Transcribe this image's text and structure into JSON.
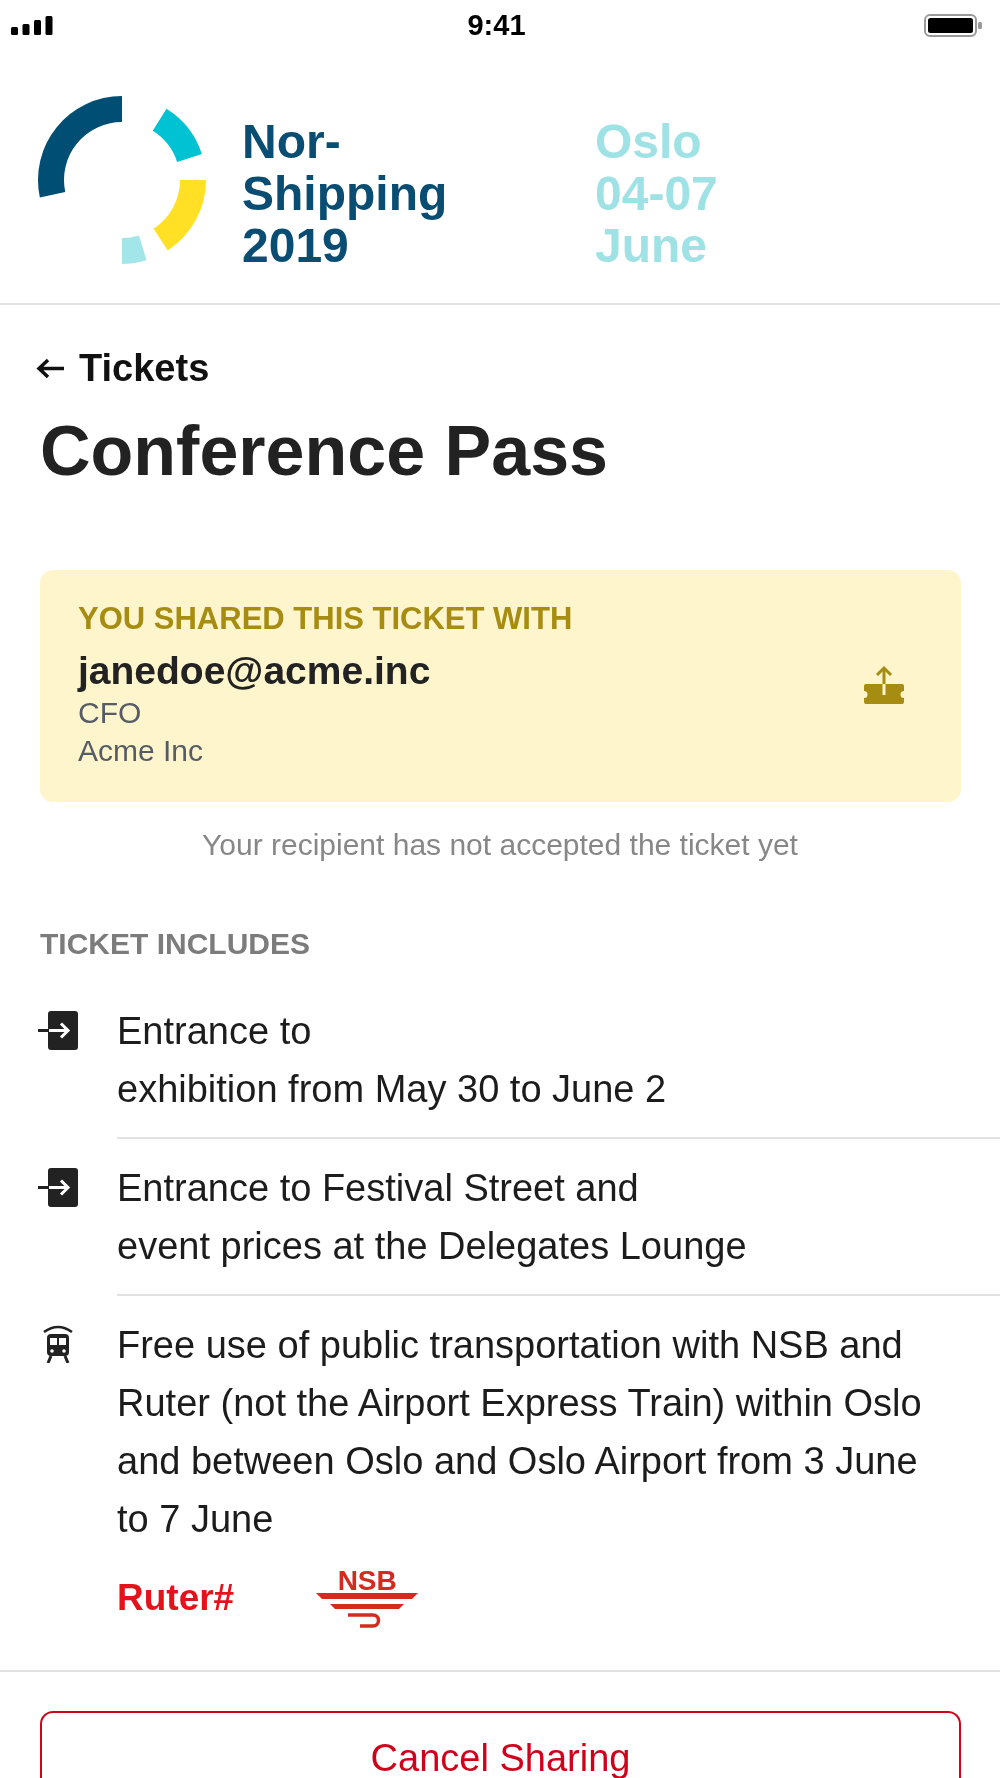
{
  "status_bar": {
    "time": "9:41"
  },
  "header": {
    "event_name_lines": [
      "Nor-",
      "Shipping",
      "2019"
    ],
    "event_info_lines": [
      "Oslo",
      "04-07",
      "June"
    ]
  },
  "back_link": {
    "label": "Tickets"
  },
  "title": "Conference Pass",
  "shared": {
    "heading": "YOU SHARED THIS TICKET WITH",
    "email": "janedoe@acme.inc",
    "role": "CFO",
    "company": "Acme Inc"
  },
  "status_note": "Your recipient has not accepted the ticket yet",
  "includes": {
    "heading": "TICKET INCLUDES",
    "items": [
      {
        "kind": "entrance",
        "lines": [
          "Entrance to",
          "exhibition from May 30 to June 2"
        ]
      },
      {
        "kind": "entrance",
        "lines": [
          "Entrance to Festival Street and",
          "event prices at the Delegates Lounge"
        ]
      },
      {
        "kind": "transport",
        "lines": [
          "Free use of public transportation with NSB and",
          "Ruter (not the Airport Express Train) within Oslo",
          "and between Oslo and Oslo Airport from 3 June",
          "to 7 June"
        ],
        "logos": [
          {
            "kind": "wordmark",
            "text": "Ruter#"
          },
          {
            "kind": "emblem",
            "text": "NSB"
          }
        ]
      }
    ]
  },
  "button": {
    "label": "Cancel Sharing"
  }
}
